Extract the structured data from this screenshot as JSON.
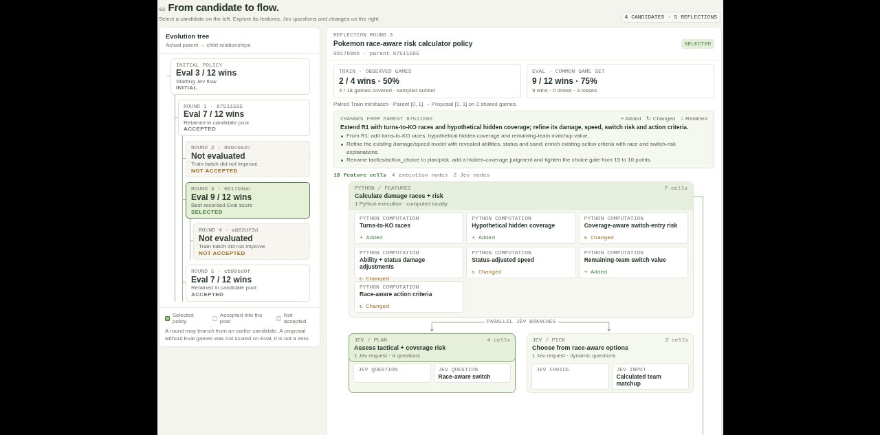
{
  "header": {
    "number": "02",
    "title": "From candidate to flow.",
    "subtitle": "Select a candidate on the left. Explore its features, Jev questions and changes on the right.",
    "counts": "4 CANDIDATES · 5 REFLECTIONS"
  },
  "tree": {
    "title": "Evolution tree",
    "subtitle": "Actual parent → child relationships",
    "nodes": [
      {
        "label": "INITIAL POLICY",
        "score": "Eval 3 / 12 wins",
        "note": "Starting Jev flow",
        "status": "INITIAL",
        "kind": "initial",
        "selected": false,
        "children": [
          {
            "label": "ROUND 1 · 87511595",
            "score": "Eval 7 / 12 wins",
            "note": "Retained in candidate pool",
            "status": "ACCEPTED",
            "kind": "accepted",
            "selected": false,
            "children": [
              {
                "label": "ROUND 2 · 809c0a2c",
                "score": "Not evaluated",
                "note": "Train batch did not improve",
                "status": "NOT ACCEPTED",
                "kind": "rejected",
                "selected": false
              },
              {
                "label": "ROUND 3 · 0617b0bb",
                "score": "Eval 9 / 12 wins",
                "note": "Best recorded Eval score",
                "status": "SELECTED",
                "kind": "accepted",
                "selected": true,
                "children": [
                  {
                    "label": "ROUND 4 · a802df3d",
                    "score": "Not evaluated",
                    "note": "Train batch did not improve",
                    "status": "NOT ACCEPTED",
                    "kind": "rejected",
                    "selected": false
                  }
                ]
              },
              {
                "label": "ROUND 5 · c699bd0f",
                "score": "Eval 7 / 12 wins",
                "note": "Retained in candidate pool",
                "status": "ACCEPTED",
                "kind": "accepted",
                "selected": false
              }
            ]
          }
        ]
      }
    ],
    "legend": [
      {
        "label": "Selected policy",
        "kind": "selected"
      },
      {
        "label": "Accepted into the pool",
        "kind": "accepted"
      },
      {
        "label": "Not accepted",
        "kind": "rejected"
      }
    ],
    "footnote": "A round may branch from an earlier candidate. A proposal without Eval games was not scored on Eval; it is not a zero."
  },
  "detail": {
    "eyebrow": "REFLECTION ROUND 3",
    "title": "Pokemon race-aware risk calculator policy",
    "badge": "SELECTED",
    "meta": "0617b0bb · parent 87511595",
    "metrics": [
      {
        "label": "TRAIN · OBSERVED GAMES",
        "value": "2 / 4 wins · 50%",
        "note": "4 / 18 games covered · sampled subset"
      },
      {
        "label": "EVAL · COMMON GAME SET",
        "value": "9 / 12 wins · 75%",
        "note": "9 wins · 0 draws · 3 losses"
      }
    ],
    "paired": "Paired Train minibatch · Parent [0, 1] → Proposal [1, 1] on 2 shared games.",
    "changes": {
      "label": "CHANGES FROM PARENT 87511595",
      "legend": [
        "+ Added",
        "↻ Changed",
        "= Retained"
      ],
      "summary": "Extend R1 with turns-to-KO races and hypothetical hidden coverage; refine its damage, speed, switch risk and action criteria.",
      "items": [
        "From R1: add turns-to-KO races, hypothetical hidden coverage and remaining-team matchup value.",
        "Refine the existing damage/speed model with revealed abilities, status and sand; enrich existing action criteria with race and switch-risk explanations.",
        "Rename tactics/action_choice to plan/pick, add a hidden-coverage judgment and tighten the choice gate from 15 to 10 points."
      ]
    },
    "counts": [
      {
        "label": "18 feature cells",
        "selected": true
      },
      {
        "label": "4 execution nodes",
        "selected": false
      },
      {
        "label": "2 Jev nodes",
        "selected": false
      }
    ],
    "python": {
      "label": "PYTHON / FEATURES",
      "count": "7 cells",
      "title": "Calculate damage races + risk",
      "note": "1 Python execution · computed locally",
      "cells": [
        {
          "label": "PYTHON COMPUTATION",
          "title": "Turns-to-KO races",
          "change": "+ Added",
          "kind": "added"
        },
        {
          "label": "PYTHON COMPUTATION",
          "title": "Hypothetical hidden coverage",
          "change": "+ Added",
          "kind": "added"
        },
        {
          "label": "PYTHON COMPUTATION",
          "title": "Coverage-aware switch-entry risk",
          "change": "↻ Changed",
          "kind": "changed"
        },
        {
          "label": "PYTHON COMPUTATION",
          "title": "Ability + status damage adjustments",
          "change": "↻ Changed",
          "kind": "changed"
        },
        {
          "label": "PYTHON COMPUTATION",
          "title": "Status-adjusted speed",
          "change": "↻ Changed",
          "kind": "changed"
        },
        {
          "label": "PYTHON COMPUTATION",
          "title": "Remaining-team switch value",
          "change": "+ Added",
          "kind": "added"
        },
        {
          "label": "PYTHON COMPUTATION",
          "title": "Race-aware action criteria",
          "change": "↻ Changed",
          "kind": "changed"
        }
      ]
    },
    "branches_label": "PARALLEL JEV BRANCHES",
    "branches": [
      {
        "label": "JEV / PLAN",
        "count": "4 cells",
        "title": "Assess tactical + coverage risk",
        "note": "1 Jev request · 4 questions",
        "selected": true,
        "cells": [
          {
            "label": "JEV QUESTION"
          },
          {
            "label": "JEV QUESTION",
            "title": "Race-aware switch"
          }
        ]
      },
      {
        "label": "JEV / PICK",
        "count": "3 cells",
        "title": "Choose from race-aware options",
        "note": "1 Jev request · dynamic questions",
        "selected": false,
        "cells": [
          {
            "label": "JEV CHOICE"
          },
          {
            "label": "JEV INPUT",
            "title": "Calculated team matchup"
          }
        ]
      }
    ]
  }
}
